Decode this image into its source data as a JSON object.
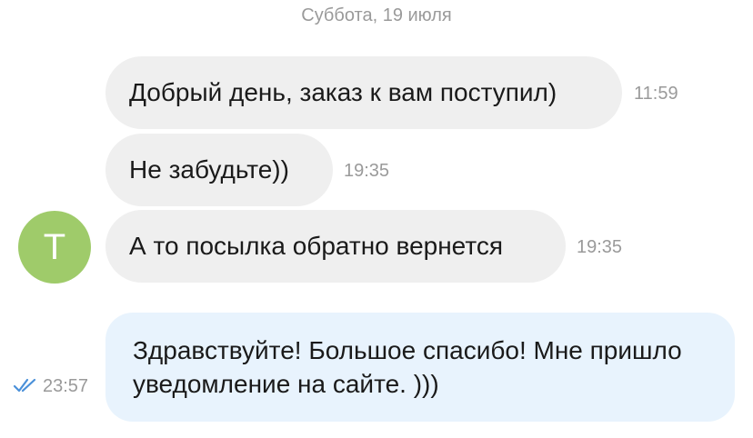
{
  "date_separator": "Суббота, 19 июля",
  "contact": {
    "avatar_letter": "Т",
    "avatar_color": "#9fcb6a"
  },
  "messages": [
    {
      "direction": "incoming",
      "text": "Добрый день, заказ к вам поступил)",
      "time": "11:59"
    },
    {
      "direction": "incoming",
      "text": "Не забудьте))",
      "time": "19:35"
    },
    {
      "direction": "incoming",
      "text": "А то посылка обратно вернется",
      "time": "19:35"
    },
    {
      "direction": "outgoing",
      "text": "Здравствуйте! Большое спасибо! Мне пришло уведомление на сайте. )))",
      "time": "23:57",
      "status_icon": "double-check-icon"
    }
  ],
  "colors": {
    "incoming_bubble": "#efefef",
    "outgoing_bubble": "#e8f3fd",
    "read_check": "#4a90d9",
    "meta_text": "#9a9a9a"
  }
}
